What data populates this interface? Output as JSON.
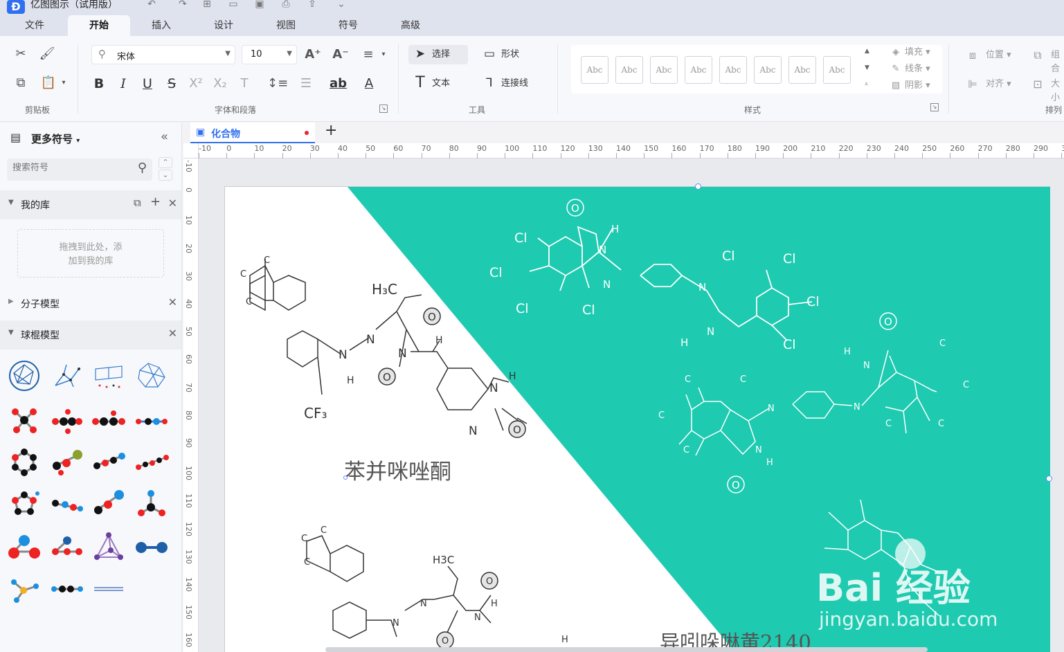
{
  "app": {
    "logo": "Ð",
    "title": "亿图图示（试用版）"
  },
  "menu": {
    "tabs": [
      "文件",
      "开始",
      "插入",
      "设计",
      "视图",
      "符号",
      "高级"
    ],
    "active": "开始"
  },
  "ribbon": {
    "groups": {
      "clipboard": "剪贴板",
      "font": "字体和段落",
      "tools": "工具",
      "styles": "样式",
      "arrange": "排列"
    },
    "font_name": "宋体",
    "font_size": "10",
    "tools": {
      "select": "选择",
      "shape": "形状",
      "text": "文本",
      "connector": "连接线"
    },
    "style_swatch_label": "Abc",
    "fill": "填充",
    "line": "线条",
    "shadow": "阴影",
    "position": "位置",
    "align": "对齐",
    "group": "组合",
    "size": "大小"
  },
  "sidebar": {
    "title": "更多符号",
    "search_placeholder": "搜索符号",
    "my_library": "我的库",
    "drop_hint_line1": "拖拽到此处，添",
    "drop_hint_line2": "加到我的库",
    "libraries": [
      "分子模型",
      "球棍模型"
    ]
  },
  "document": {
    "tab_name": "化合物",
    "add_tab": "+"
  },
  "rulers": {
    "h_ticks": [
      "-10",
      "0",
      "10",
      "20",
      "30",
      "40",
      "50",
      "60",
      "70",
      "80",
      "90",
      "100",
      "110",
      "120",
      "130",
      "140",
      "150",
      "160",
      "170",
      "180",
      "190",
      "200",
      "210",
      "220",
      "230",
      "240",
      "250",
      "260",
      "270",
      "280",
      "290",
      "3"
    ],
    "v_ticks": [
      "-10",
      "0",
      "10",
      "20",
      "30",
      "40",
      "50",
      "60",
      "70",
      "80",
      "90",
      "100",
      "110",
      "120",
      "130",
      "140",
      "150",
      "160"
    ]
  },
  "canvas": {
    "accent_color": "#1ecab0",
    "caption_1": "苯并咪唑酮",
    "caption_2": "异吲哚啉黄2140",
    "labels": {
      "h3c": "H₃C",
      "h3c_plain": "H3C",
      "cf3": "CF₃",
      "n": "N",
      "h": "H",
      "o": "O",
      "c": "C",
      "cl": "Cl"
    },
    "watermark_brand": "Bai  经验",
    "watermark_url": "jingyan.baidu.com"
  }
}
